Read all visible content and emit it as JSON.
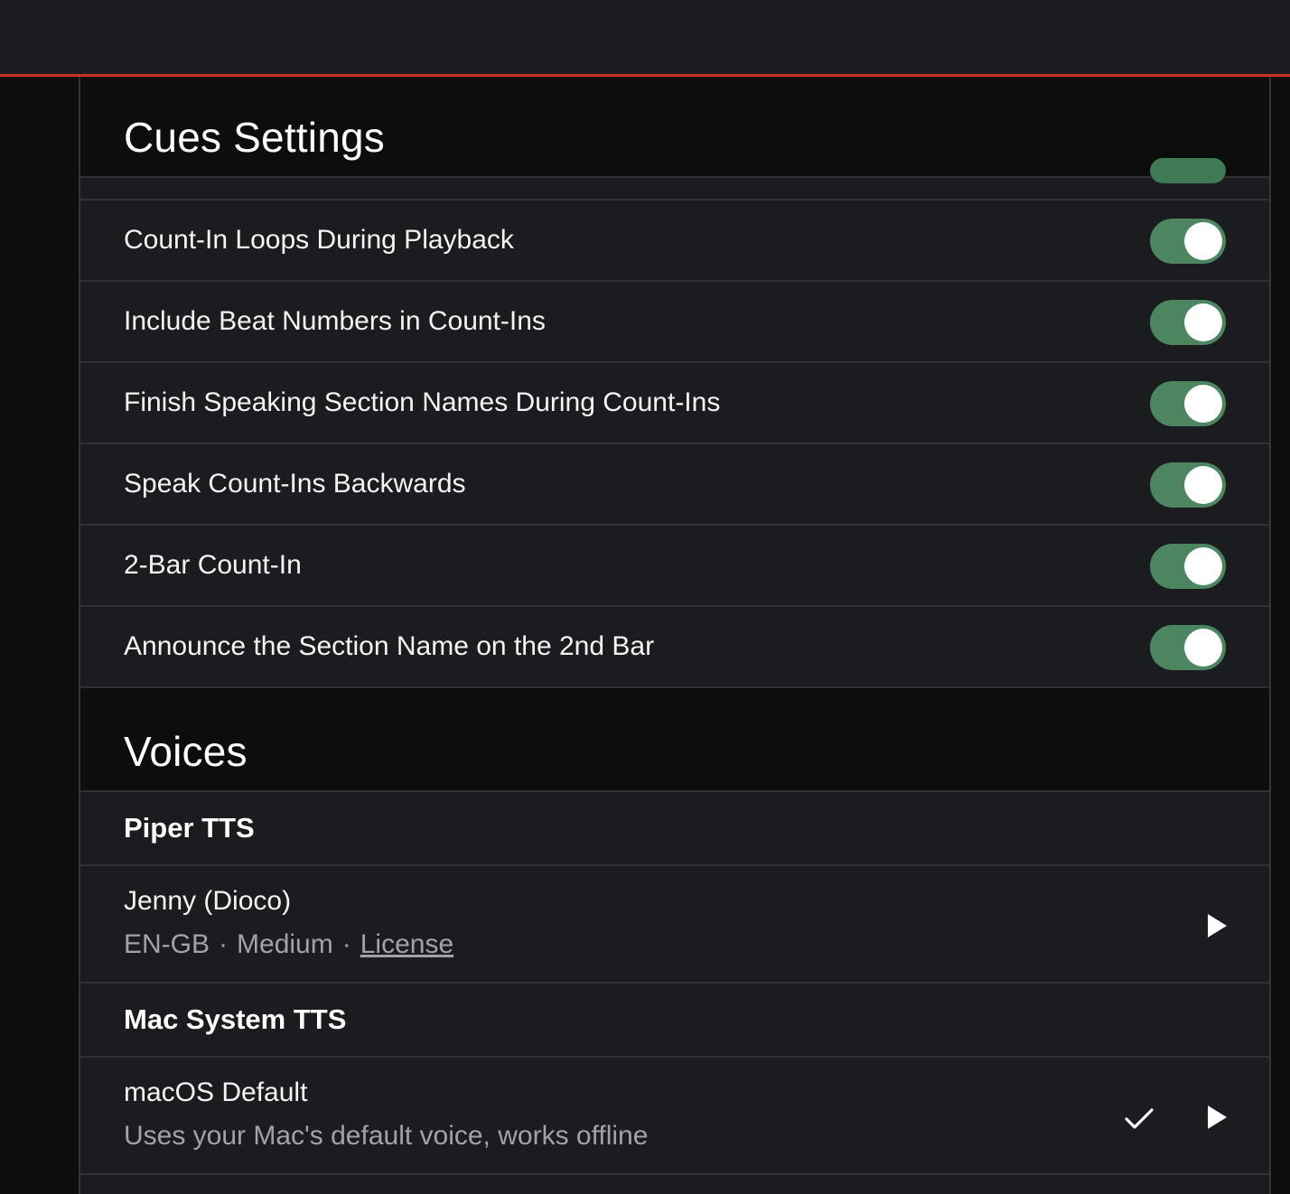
{
  "colors": {
    "accent_red": "#c9302c",
    "toggle_on": "#4c8560",
    "background": "#1b1c1f",
    "header_bg": "#0c0e0e"
  },
  "cues_settings": {
    "title": "Cues Settings",
    "toggles": [
      {
        "label": "Count-In Loops During Playback",
        "on": true
      },
      {
        "label": "Include Beat Numbers in Count-Ins",
        "on": true
      },
      {
        "label": "Finish Speaking Section Names During Count-Ins",
        "on": true
      },
      {
        "label": "Speak Count-Ins Backwards",
        "on": true
      },
      {
        "label": "2-Bar Count-In",
        "on": true
      },
      {
        "label": "Announce the Section Name on the 2nd Bar",
        "on": true
      }
    ]
  },
  "voices": {
    "title": "Voices",
    "groups": [
      {
        "name": "Piper TTS",
        "voices": [
          {
            "name": "Jenny (Dioco)",
            "language": "EN-GB",
            "quality": "Medium",
            "separator": "·",
            "license_label": "License",
            "selected": false,
            "play_icon": "play-icon"
          }
        ]
      },
      {
        "name": "Mac System TTS",
        "voices": [
          {
            "name": "macOS Default",
            "description": "Uses your Mac's default voice, works offline",
            "selected": true,
            "check_icon": "checkmark-icon",
            "play_icon": "play-icon"
          }
        ]
      }
    ]
  }
}
